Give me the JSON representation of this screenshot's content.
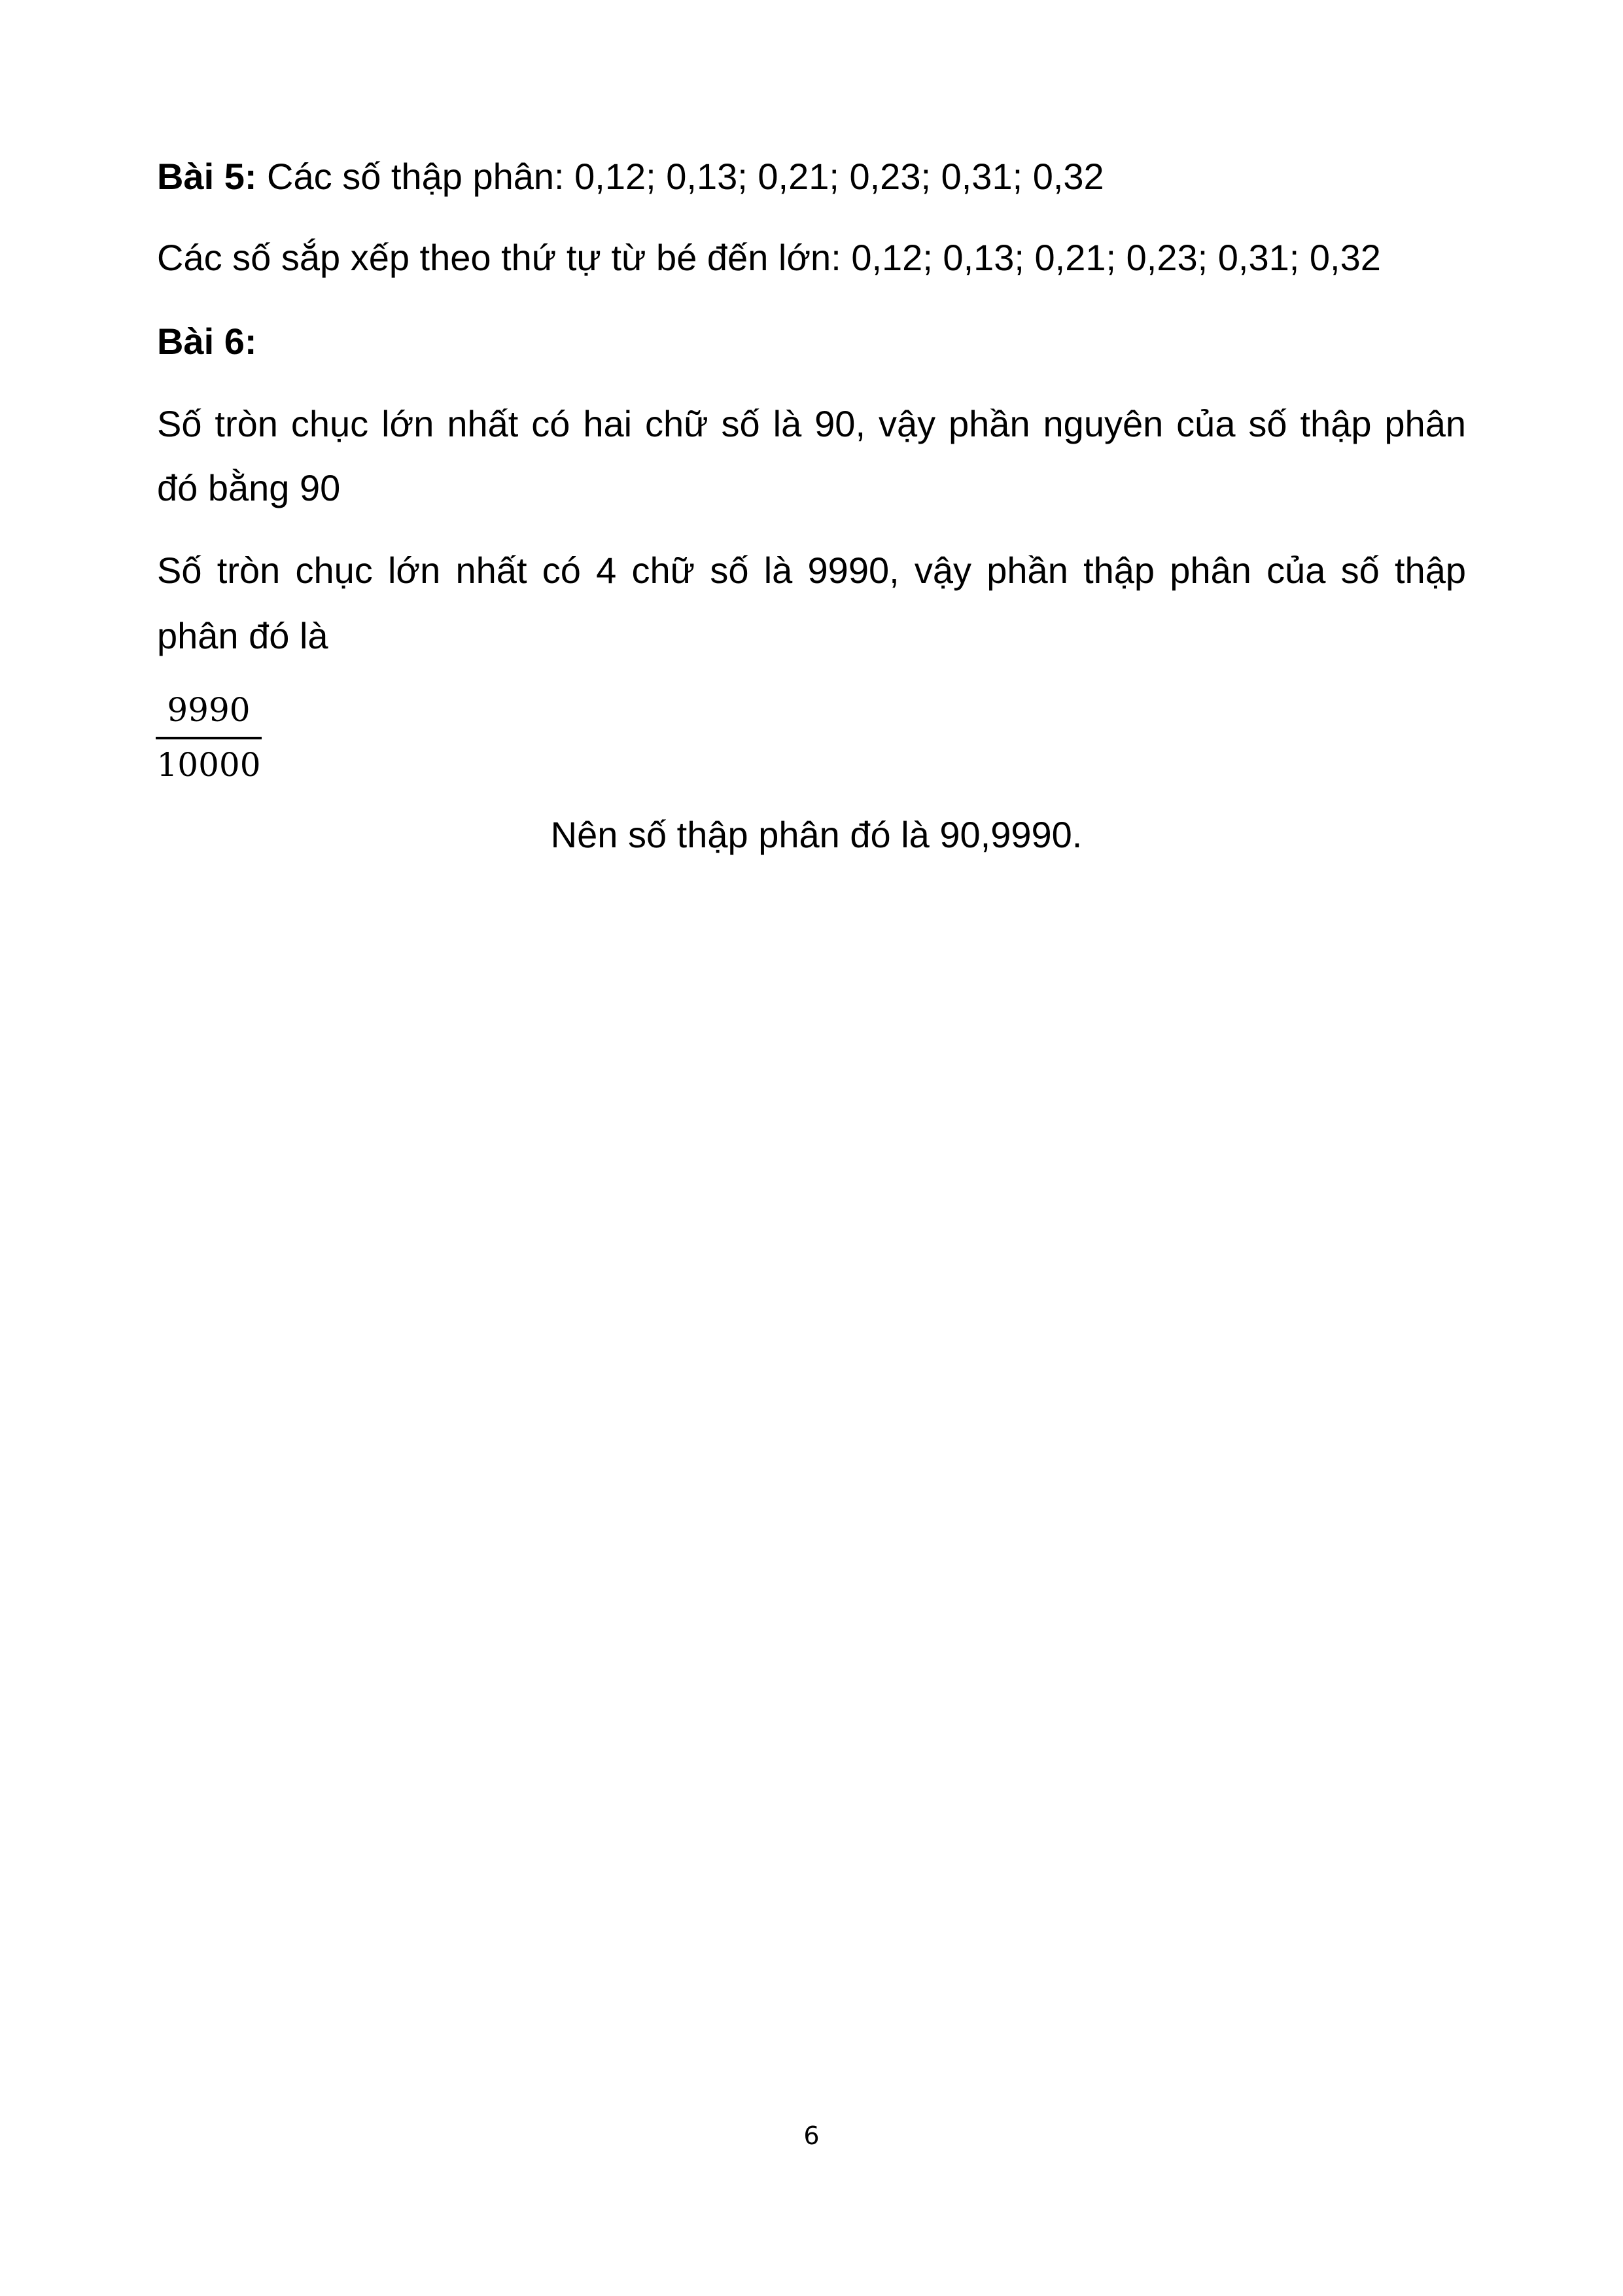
{
  "bai5": {
    "heading": "Bài 5:",
    "text": " Các số thập phân: 0,12; 0,13; 0,21; 0,23; 0,31; 0,32",
    "sorted": "Các số sắp xếp theo thứ tự từ bé đến lớn: 0,12; 0,13; 0,21; 0,23; 0,31; 0,32"
  },
  "bai6": {
    "heading": "Bài 6:",
    "para1_line1": "Số tròn chục lớn nhất có hai chữ số là 90, vậy phần nguyên của số thập phân",
    "para1_line2": "đó bằng 90",
    "para2_line1": "Số tròn chục lớn nhất có 4 chữ số là 9990, vậy phần thập phân của số thập",
    "para2_line2": "phân đó là",
    "fraction": {
      "numerator": "9990",
      "denominator": "10000"
    },
    "conclusion": "Nên số thập phân đó là 90,9990."
  },
  "page_number": "6"
}
